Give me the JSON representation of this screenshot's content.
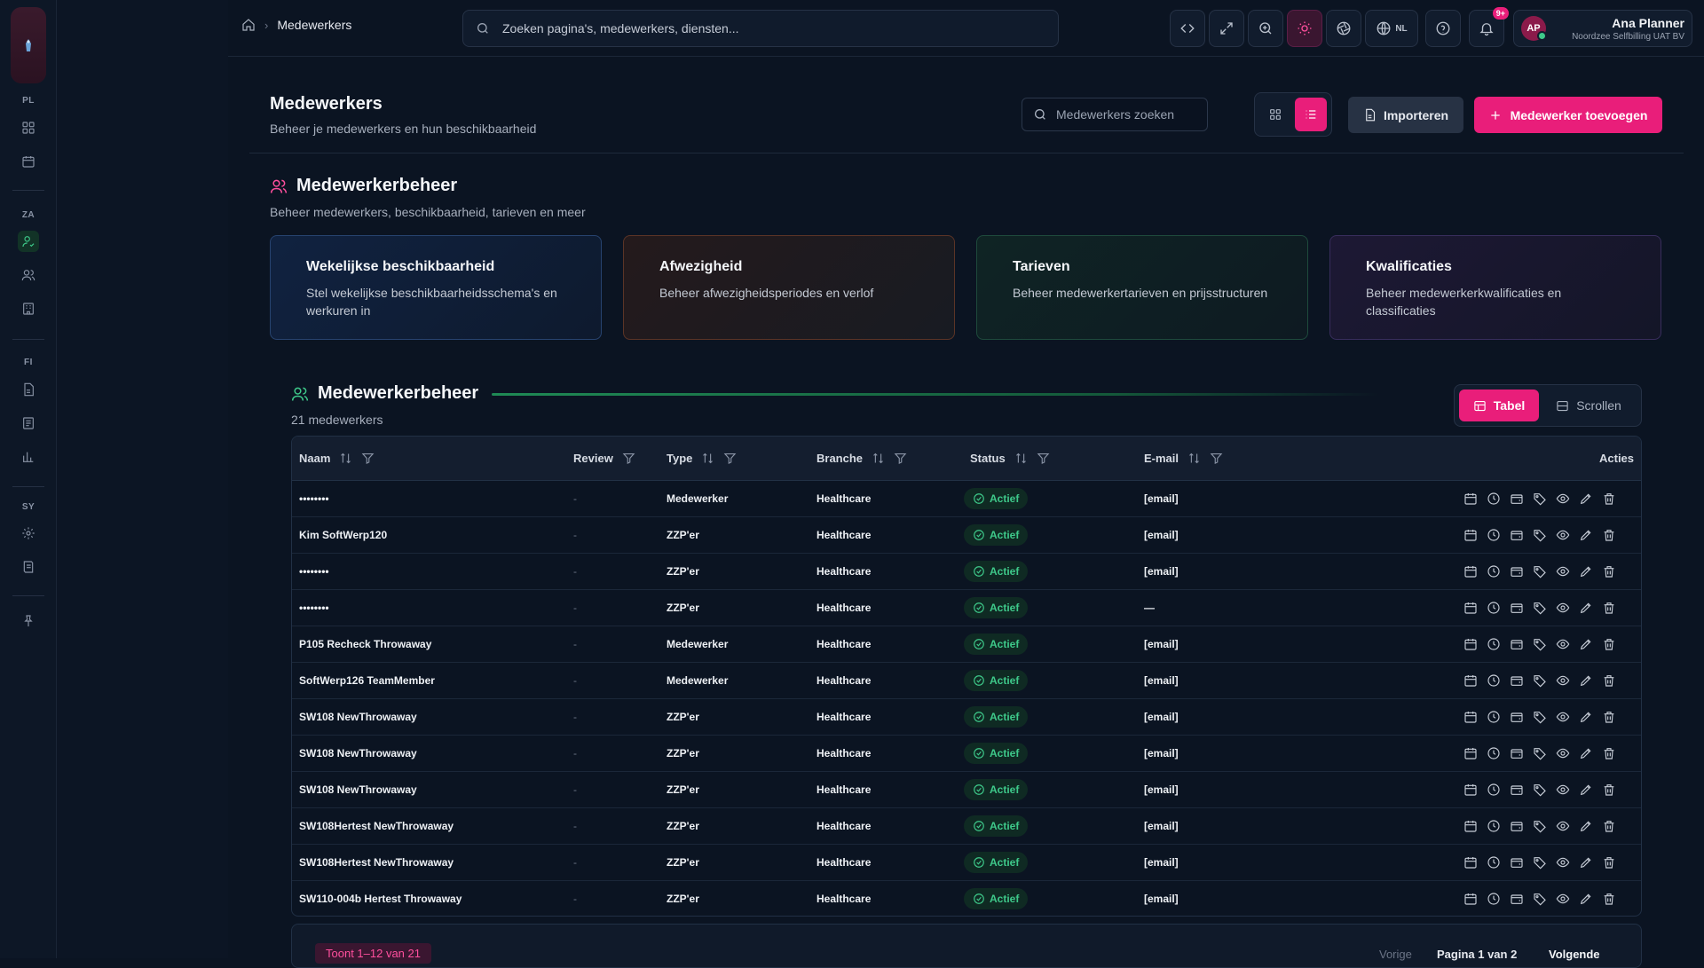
{
  "rail": {
    "groups": [
      "PL",
      "ZA",
      "FI",
      "SY"
    ]
  },
  "topbar": {
    "breadcrumb_current": "Medewerkers",
    "search_placeholder": "Zoeken pagina's, medewerkers, diensten...",
    "language": "NL",
    "notification_badge": "9+",
    "user": {
      "initials": "AP",
      "name": "Ana Planner",
      "org": "Noordzee Selfbilling UAT BV"
    }
  },
  "header": {
    "title": "Medewerkers",
    "subtitle": "Beheer je medewerkers en hun beschikbaarheid",
    "search_placeholder": "Medewerkers zoeken",
    "import_label": "Importeren",
    "add_label": "Medewerker toevoegen"
  },
  "management": {
    "title": "Medewerkerbeheer",
    "subtitle": "Beheer medewerkers, beschikbaarheid, tarieven en meer",
    "cards": [
      {
        "title": "Wekelijkse beschikbaarheid",
        "desc": "Stel wekelijkse beschikbaarheidsschema's en werkuren in"
      },
      {
        "title": "Afwezigheid",
        "desc": "Beheer afwezigheidsperiodes en verlof"
      },
      {
        "title": "Tarieven",
        "desc": "Beheer medewerkertarieven en prijsstructuren"
      },
      {
        "title": "Kwalificaties",
        "desc": "Beheer medewerkerkwalificaties en classificaties"
      }
    ]
  },
  "list": {
    "title": "Medewerkerbeheer",
    "count": "21 medewerkers",
    "tab_table": "Tabel",
    "tab_scroll": "Scrollen",
    "columns": {
      "name": "Naam",
      "review": "Review",
      "type": "Type",
      "branche": "Branche",
      "status": "Status",
      "email": "E-mail",
      "actions": "Acties"
    },
    "rows": [
      {
        "name": "••••••••",
        "review": "-",
        "type": "Medewerker",
        "branche": "Healthcare",
        "status": "Actief",
        "email": "[email]"
      },
      {
        "name": "Kim SoftWerp120",
        "review": "-",
        "type": "ZZP'er",
        "branche": "Healthcare",
        "status": "Actief",
        "email": "[email]"
      },
      {
        "name": "••••••••",
        "review": "-",
        "type": "ZZP'er",
        "branche": "Healthcare",
        "status": "Actief",
        "email": "[email]"
      },
      {
        "name": "••••••••",
        "review": "-",
        "type": "ZZP'er",
        "branche": "Healthcare",
        "status": "Actief",
        "email": "—"
      },
      {
        "name": "P105 Recheck Throwaway",
        "review": "-",
        "type": "Medewerker",
        "branche": "Healthcare",
        "status": "Actief",
        "email": "[email]"
      },
      {
        "name": "SoftWerp126 TeamMember",
        "review": "-",
        "type": "Medewerker",
        "branche": "Healthcare",
        "status": "Actief",
        "email": "[email]"
      },
      {
        "name": "SW108 NewThrowaway",
        "review": "-",
        "type": "ZZP'er",
        "branche": "Healthcare",
        "status": "Actief",
        "email": "[email]"
      },
      {
        "name": "SW108 NewThrowaway",
        "review": "-",
        "type": "ZZP'er",
        "branche": "Healthcare",
        "status": "Actief",
        "email": "[email]"
      },
      {
        "name": "SW108 NewThrowaway",
        "review": "-",
        "type": "ZZP'er",
        "branche": "Healthcare",
        "status": "Actief",
        "email": "[email]"
      },
      {
        "name": "SW108Hertest NewThrowaway",
        "review": "-",
        "type": "ZZP'er",
        "branche": "Healthcare",
        "status": "Actief",
        "email": "[email]"
      },
      {
        "name": "SW108Hertest NewThrowaway",
        "review": "-",
        "type": "ZZP'er",
        "branche": "Healthcare",
        "status": "Actief",
        "email": "[email]"
      },
      {
        "name": "SW110-004b Hertest Throwaway",
        "review": "-",
        "type": "ZZP'er",
        "branche": "Healthcare",
        "status": "Actief",
        "email": "[email]"
      }
    ],
    "pagination": {
      "info": "Toont 1–12 van 21",
      "prev": "Vorige",
      "page": "Pagina 1 van 2",
      "next": "Volgende"
    }
  },
  "colors": {
    "accent": "#e91e7a",
    "success": "#3ec98a",
    "background": "#0b1422"
  }
}
